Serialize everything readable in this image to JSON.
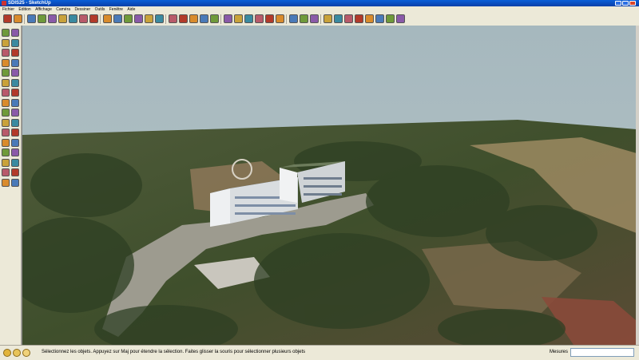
{
  "window": {
    "title": "SDIS25 - SketchUp"
  },
  "menu": [
    "Fichier",
    "Edition",
    "Affichage",
    "Caméra",
    "Dessiner",
    "Outils",
    "Fenêtre",
    "Aide"
  ],
  "status": {
    "hint": "Sélectionnez les objets. Appuyez sur Maj pour étendre la sélection. Faites glisser la souris pour sélectionner plusieurs objets",
    "measures_label": "Mesures",
    "measures_value": ""
  },
  "toolbar_icons": [
    "select-icon",
    "line-icon",
    "rectangle-icon",
    "circle-icon",
    "arc-icon",
    "polygon-icon",
    "eraser-icon",
    "tape-measure-icon",
    "paint-bucket-icon",
    "push-pull-icon",
    "move-icon",
    "rotate-icon",
    "follow-me-icon",
    "scale-icon",
    "offset-icon",
    "orbit-icon",
    "pan-icon",
    "zoom-icon",
    "zoom-window-icon",
    "zoom-extents-icon",
    "get-models-icon",
    "share-model-icon",
    "place-model-icon",
    "add-location-icon",
    "toggle-terrain-icon",
    "photo-textures-icon",
    "dimension-icon",
    "text-icon",
    "section-plane-icon",
    "iso-view-icon",
    "top-view-icon",
    "front-view-icon",
    "right-view-icon",
    "back-view-icon",
    "left-view-icon",
    "xray-icon",
    "wireframe-icon"
  ],
  "left_icons": [
    "select-icon",
    "component-icon",
    "paint-bucket-icon",
    "eraser-icon",
    "rectangle-icon",
    "line-icon",
    "circle-icon",
    "arc-icon",
    "polygon-icon",
    "freehand-icon",
    "move-icon",
    "push-pull-icon",
    "rotate-icon",
    "follow-me-icon",
    "scale-icon",
    "offset-icon",
    "tape-measure-icon",
    "dimension-icon",
    "protractor-icon",
    "text-icon",
    "axes-icon",
    "3d-text-icon",
    "orbit-icon",
    "pan-icon",
    "zoom-icon",
    "zoom-window-icon",
    "previous-view-icon",
    "zoom-extents-icon",
    "position-camera-icon",
    "walk-icon",
    "look-around-icon",
    "section-plane-icon"
  ],
  "colors": {
    "sky": "#adbec3",
    "chrome": "#ece9d8",
    "titlebar": "#0a4fc8"
  }
}
